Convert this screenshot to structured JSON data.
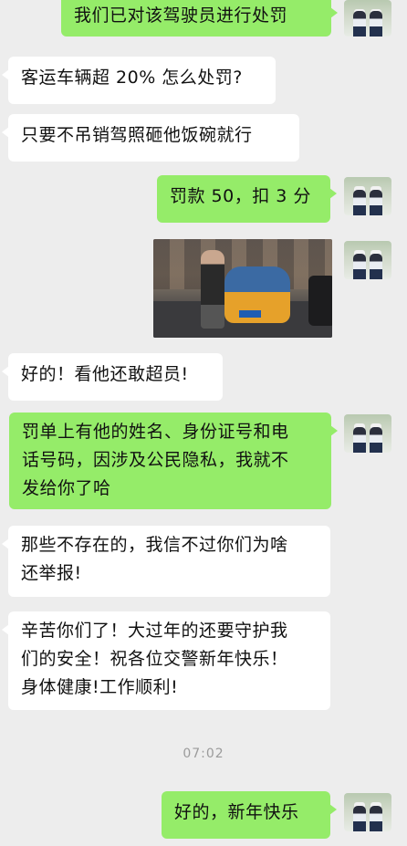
{
  "messages": [
    {
      "side": "out",
      "text": "我们已对该驾驶员进行处罚"
    },
    {
      "side": "in",
      "text": "客运车辆超 20% 怎么处罚?"
    },
    {
      "side": "in",
      "text": "只要不吊销驾照砸他饭碗就行"
    },
    {
      "side": "out",
      "text": "罚款 50，扣 3 分"
    },
    {
      "side": "out",
      "image": "photo-car-overloaded"
    },
    {
      "side": "in",
      "text": "好的！看他还敢超员!"
    },
    {
      "side": "out",
      "text": "罚单上有他的姓名、身份证号和电\n话号码，因涉及公民隐私，我就不\n发给你了哈"
    },
    {
      "side": "in",
      "text": "那些不存在的，我信不过你们为啥\n还举报!"
    },
    {
      "side": "in",
      "text": "辛苦你们了！大过年的还要守护我\n们的安全！祝各位交警新年快乐！\n身体健康!工作顺利!"
    },
    {
      "side": "out",
      "text": "好的，新年快乐"
    }
  ],
  "timestamp": "07:02",
  "avatar_icon": "traffic-police-avatar-icon",
  "colors": {
    "background": "#ededed",
    "outgoing_bubble": "#95ec69",
    "incoming_bubble": "#ffffff"
  }
}
